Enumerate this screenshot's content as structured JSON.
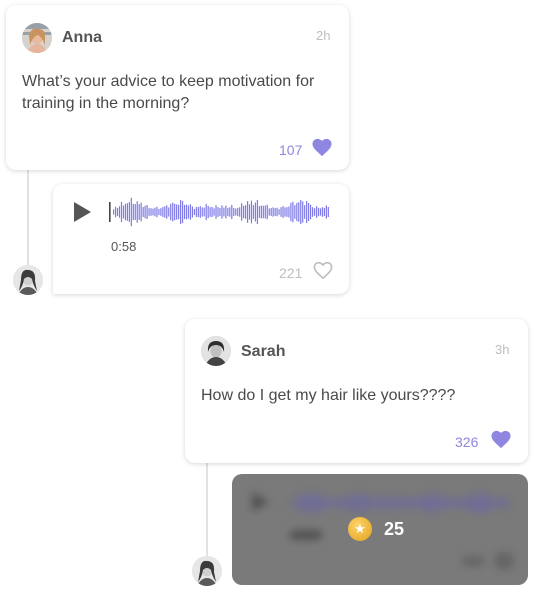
{
  "post1": {
    "author": "Anna",
    "time": "2h",
    "text": "What’s your advice to keep motivation for training in the morning?",
    "likes": "107",
    "liked": true
  },
  "reply1": {
    "duration": "0:58",
    "likes": "221",
    "liked": false
  },
  "post2": {
    "author": "Sarah",
    "time": "3h",
    "text": "How do I get my hair like yours????",
    "likes": "326",
    "liked": true
  },
  "reply2": {
    "locked": true,
    "coin_price": "25"
  },
  "colors": {
    "accent": "#8e86e0",
    "waveform": "#7f7ae6",
    "coin": "#e8ad2b",
    "locked_overlay": "#7a7a7a"
  },
  "icons": {
    "liked": "heart-filled-icon",
    "unliked": "heart-outline-icon",
    "play": "play-icon",
    "coin": "star-coin-icon"
  }
}
